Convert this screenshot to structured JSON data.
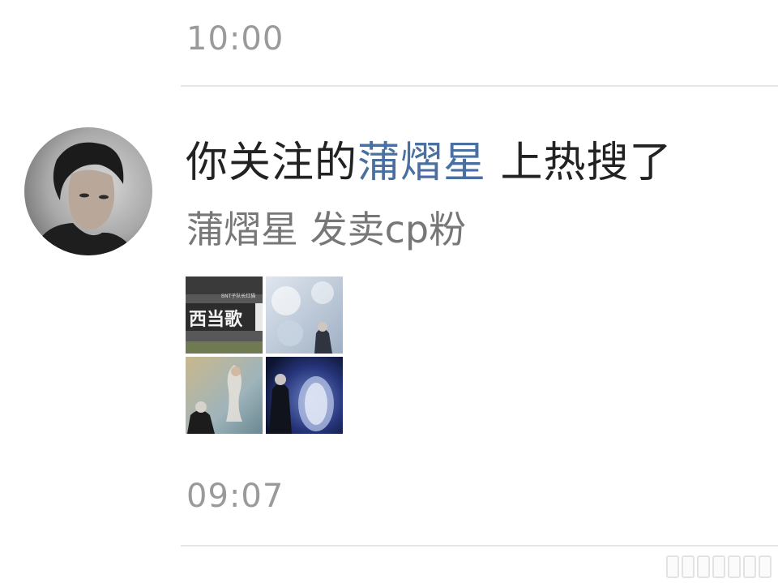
{
  "times": {
    "top": "10:00",
    "bottom": "09:07"
  },
  "notification": {
    "prefix": "你关注的",
    "name": "蒲熠星",
    "suffix": " 上热搜了",
    "topic": "蒲熠星 发卖cp粉",
    "colors": {
      "name_link": "#4a6fa1",
      "headline": "#222222",
      "topic": "#777777",
      "time": "#9a9a9a"
    }
  },
  "thumbnails": {
    "first": {
      "banner_text": "西当歌",
      "small_text": "BNT子队长红猫"
    },
    "count": 4
  }
}
